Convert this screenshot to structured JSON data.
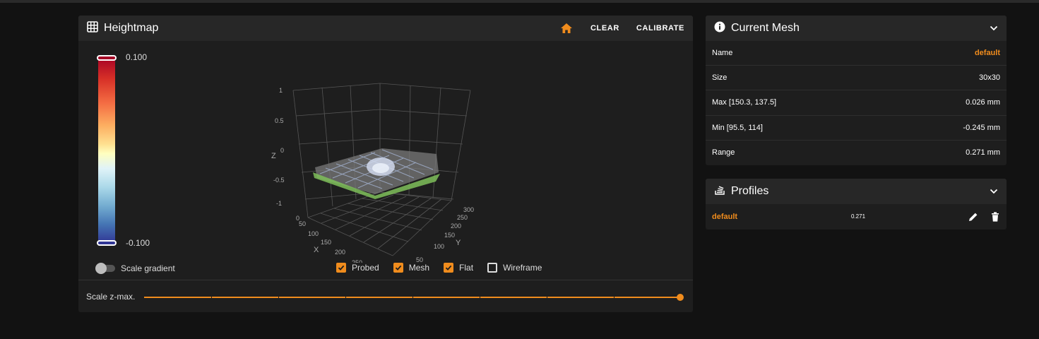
{
  "heightmap": {
    "title": "Heightmap",
    "icon": "grid-icon",
    "buttons": {
      "home": "home-icon",
      "clear": "CLEAR",
      "calibrate": "CALIBRATE"
    },
    "legend": {
      "max": "0.100",
      "min": "-0.100"
    },
    "scale_gradient": {
      "label": "Scale gradient",
      "enabled": false
    },
    "checkboxes": [
      {
        "label": "Probed",
        "checked": true
      },
      {
        "label": "Mesh",
        "checked": true
      },
      {
        "label": "Flat",
        "checked": true
      },
      {
        "label": "Wireframe",
        "checked": false
      }
    ],
    "scale_zmax": {
      "label": "Scale z-max.",
      "value": 1.0
    },
    "plot": {
      "z_axis": {
        "label": "Z",
        "ticks": [
          "1",
          "0.5",
          "0",
          "-0.5",
          "-1"
        ]
      },
      "x_axis": {
        "label": "X",
        "ticks": [
          "0",
          "50",
          "100",
          "150",
          "200",
          "250"
        ]
      },
      "y_axis": {
        "label": "Y",
        "ticks": [
          "300",
          "250",
          "200",
          "150",
          "100",
          "50"
        ]
      }
    },
    "accent": "#f08c1d"
  },
  "current_mesh": {
    "title": "Current Mesh",
    "icon": "info-icon",
    "rows": [
      {
        "label": "Name",
        "value": "default",
        "accent": true
      },
      {
        "label": "Size",
        "value": "30x30"
      },
      {
        "label": "Max [150.3, 137.5]",
        "value": "0.026 mm"
      },
      {
        "label": "Min [95.5, 114]",
        "value": "-0.245 mm"
      },
      {
        "label": "Range",
        "value": "0.271 mm"
      }
    ]
  },
  "profiles": {
    "title": "Profiles",
    "icon": "stack-icon",
    "items": [
      {
        "name": "default",
        "value": "0.271"
      }
    ]
  }
}
